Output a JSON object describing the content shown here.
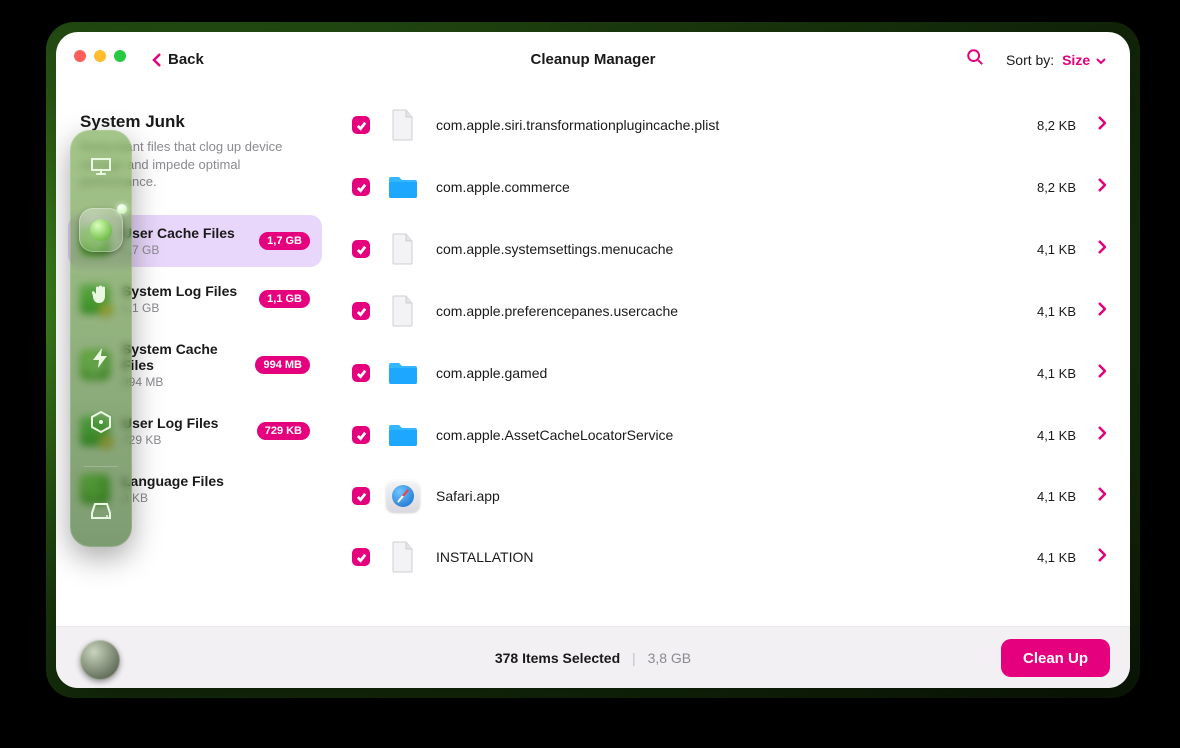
{
  "header": {
    "back_label": "Back",
    "title": "Cleanup Manager",
    "sort_label": "Sort by:",
    "sort_value": "Size"
  },
  "section": {
    "title": "System Junk",
    "desc": "Redundant files that clog up device storage and impede optimal performance."
  },
  "categories": [
    {
      "name": "User Cache Files",
      "sub": "1,7 GB",
      "badge": "1,7 GB",
      "icon": "clock",
      "active": true
    },
    {
      "name": "System Log Files",
      "sub": "1,1 GB",
      "badge": "1,1 GB",
      "icon": "doc",
      "active": false
    },
    {
      "name": "System Cache Files",
      "sub": "994 MB",
      "badge": "994 MB",
      "icon": "clock",
      "active": false
    },
    {
      "name": "User Log Files",
      "sub": "729 KB",
      "badge": "729 KB",
      "icon": "doc",
      "active": false
    },
    {
      "name": "Language Files",
      "sub": "0 KB",
      "badge": "",
      "icon": "lang",
      "active": false
    }
  ],
  "files": [
    {
      "name": "com.apple.siri.transformationplugincache.plist",
      "size": "8,2 KB",
      "icon": "page"
    },
    {
      "name": "com.apple.commerce",
      "size": "8,2 KB",
      "icon": "folder"
    },
    {
      "name": "com.apple.systemsettings.menucache",
      "size": "4,1 KB",
      "icon": "page"
    },
    {
      "name": "com.apple.preferencepanes.usercache",
      "size": "4,1 KB",
      "icon": "page"
    },
    {
      "name": "com.apple.gamed",
      "size": "4,1 KB",
      "icon": "folder"
    },
    {
      "name": "com.apple.AssetCacheLocatorService",
      "size": "4,1 KB",
      "icon": "folder"
    },
    {
      "name": "Safari.app",
      "size": "4,1 KB",
      "icon": "safari"
    },
    {
      "name": "INSTALLATION",
      "size": "4,1 KB",
      "icon": "page"
    }
  ],
  "footer": {
    "selected_label": "378 Items Selected",
    "total_size": "3,8 GB",
    "cleanup_label": "Clean Up"
  }
}
